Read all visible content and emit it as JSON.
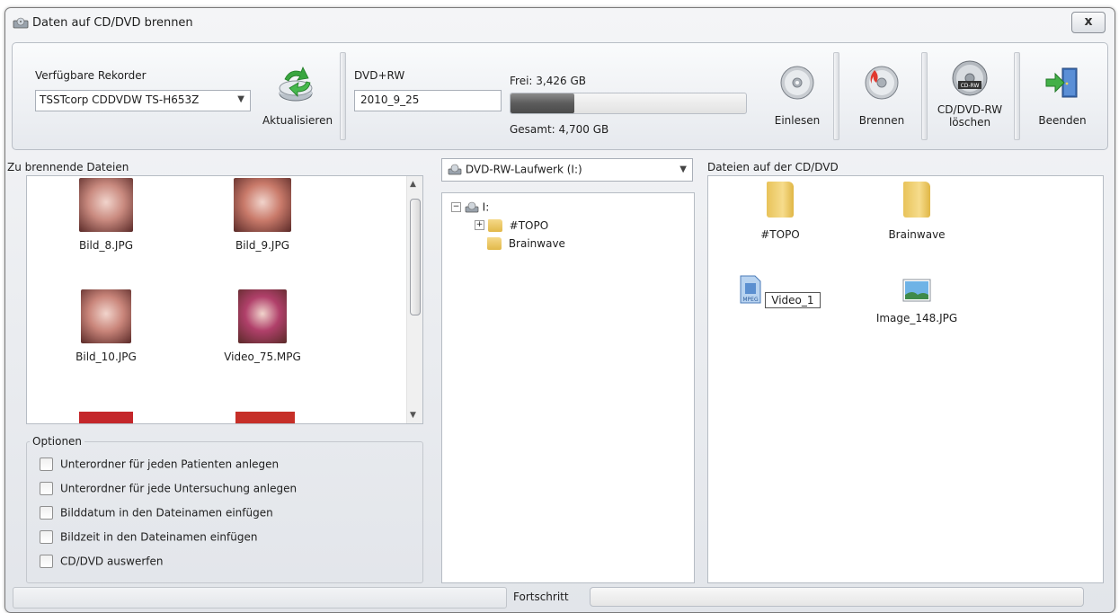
{
  "window": {
    "title": "Daten auf CD/DVD brennen",
    "close_label": "x"
  },
  "toolbar": {
    "recorder_label": "Verfügbare Rekorder",
    "recorder_value": "TSSTcorp CDDVDW TS-H653Z",
    "refresh_label": "Aktualisieren",
    "disc_type": "DVD+RW",
    "disc_name": "2010_9_25",
    "free_label": "Frei: 3,426 GB",
    "total_label": "Gesamt: 4,700 GB",
    "used_fraction": 0.27,
    "read_label": "Einlesen",
    "burn_label": "Brennen",
    "erase_label_1": "CD/DVD-RW",
    "erase_label_2": "löschen",
    "exit_label": "Beenden",
    "cd_rw_badge": "CD-RW"
  },
  "left_panel": {
    "header": "Zu brennende Dateien",
    "files": [
      {
        "name": "Bild_8.JPG",
        "color": "#c98a7f"
      },
      {
        "name": "Bild_9.JPG",
        "color": "#c97a6a"
      },
      {
        "name": "Bild_10.JPG",
        "color": "#c9857a"
      },
      {
        "name": "Video_75.MPG",
        "color": "#b0406a"
      }
    ]
  },
  "options": {
    "header": "Optionen",
    "items": [
      "Unterordner für jeden Patienten anlegen",
      "Unterordner für jede Untersuchung anlegen",
      "Bilddatum in den Dateinamen einfügen",
      "Bildzeit in den Dateinamen einfügen",
      "CD/DVD auswerfen"
    ]
  },
  "middle_panel": {
    "drive_select": "DVD-RW-Laufwerk (I:)",
    "tree_root": "I:",
    "tree_children": [
      "#TOPO",
      "Brainwave"
    ]
  },
  "right_panel": {
    "header": "Dateien auf der CD/DVD",
    "items": [
      {
        "name": "#TOPO",
        "kind": "folder"
      },
      {
        "name": "Brainwave",
        "kind": "folder"
      },
      {
        "name": "Video_1",
        "kind": "mpeg",
        "badge": "MPEG"
      },
      {
        "name": "Image_148.JPG",
        "kind": "image"
      }
    ]
  },
  "statusbar": {
    "progress_label": "Fortschritt",
    "progress_value": 0
  }
}
